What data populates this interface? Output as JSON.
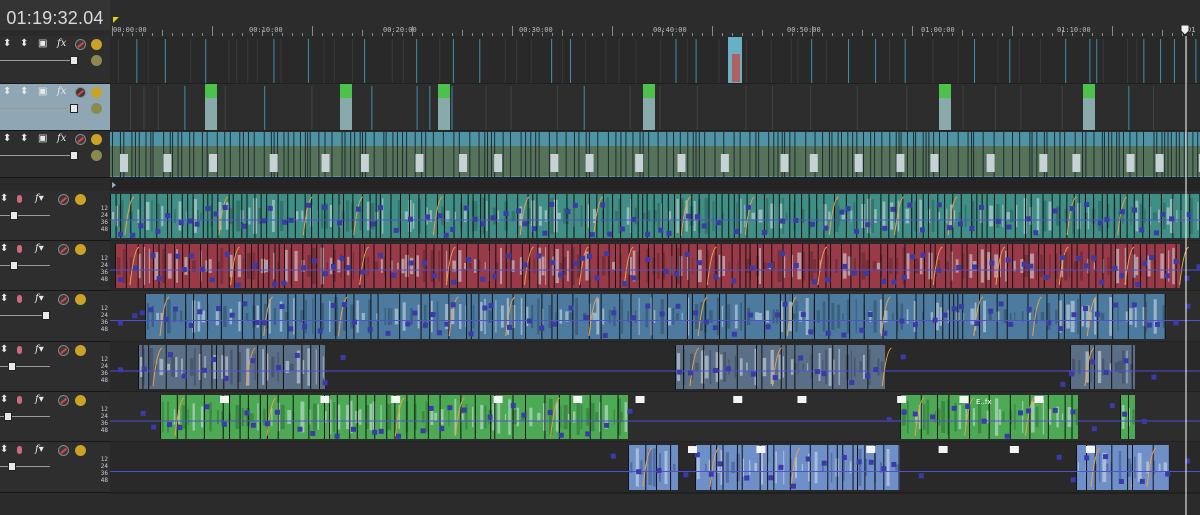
{
  "timecode": "01:19:32.04",
  "ruler": {
    "labels": [
      "00:00:00",
      "00:10:00",
      "00:20:00",
      "00:30:00",
      "00:40:00",
      "00:50:00",
      "01:00:00",
      "01:10:00",
      "01"
    ]
  },
  "video_tracks": [
    {
      "name": "video-track-1",
      "selected": false,
      "fx_icon": "fx-icon"
    },
    {
      "name": "video-track-2",
      "selected": true,
      "fx_icon": "fx-icon"
    },
    {
      "name": "video-track-3",
      "selected": false,
      "fx_icon": "fx-chain-icon"
    }
  ],
  "audio_tracks": [
    {
      "name": "audio-track-1",
      "color": "#3f8f86",
      "dark": "#2a5e58",
      "db_labels": [
        "12",
        "24",
        "36",
        "48"
      ]
    },
    {
      "name": "audio-track-2",
      "color": "#9a3a48",
      "dark": "#5e2630",
      "db_labels": [
        "12",
        "24",
        "36",
        "48"
      ]
    },
    {
      "name": "audio-track-3",
      "color": "#4d7ba0",
      "dark": "#2f4d66",
      "db_labels": [
        "12",
        "24",
        "36",
        "48"
      ]
    },
    {
      "name": "audio-track-4",
      "color": "#5a6e86",
      "dark": "#38465a",
      "db_labels": [
        "12",
        "24",
        "36",
        "48"
      ]
    },
    {
      "name": "audio-track-5",
      "color": "#4caa55",
      "dark": "#2e6e35",
      "db_labels": [
        "12",
        "24",
        "36",
        "48"
      ]
    },
    {
      "name": "audio-track-6",
      "color": "#6f8fc9",
      "dark": "#3d5684",
      "db_labels": [
        "12",
        "24",
        "36",
        "48"
      ]
    }
  ],
  "clip_caption": "E..fx",
  "colors": {
    "envelope": "#3a3aa8",
    "automation": "#5050d0",
    "playhead": "#ffffff",
    "marker": "#e8d000"
  }
}
